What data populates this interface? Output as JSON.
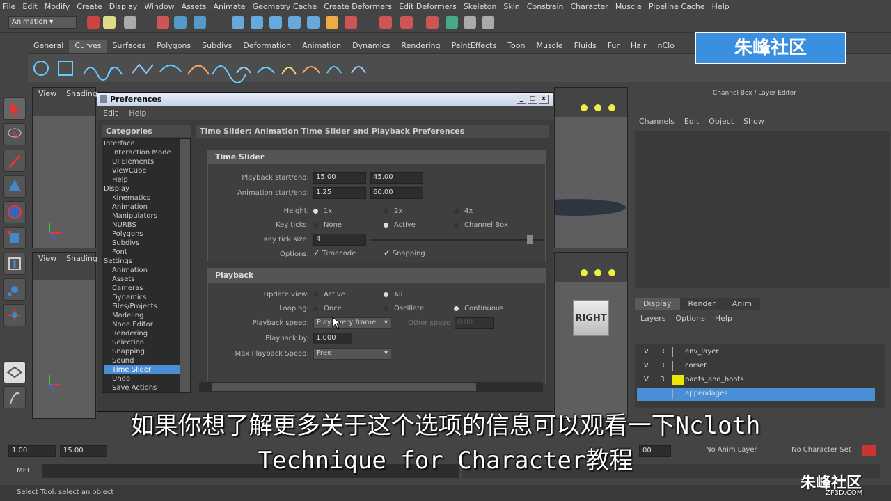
{
  "menubar": [
    "File",
    "Edit",
    "Modify",
    "Create",
    "Display",
    "Window",
    "Assets",
    "Animate",
    "Geometry Cache",
    "Create Deformers",
    "Edit Deformers",
    "Skeleton",
    "Skin",
    "Constrain",
    "Character",
    "Muscle",
    "Pipeline Cache",
    "Help"
  ],
  "mode_selector": "Animation",
  "shelf_tabs": [
    "General",
    "Curves",
    "Surfaces",
    "Polygons",
    "Subdivs",
    "Deformation",
    "Animation",
    "Dynamics",
    "Rendering",
    "PaintEffects",
    "Toon",
    "Muscle",
    "Fluids",
    "Fur",
    "Hair",
    "nClo"
  ],
  "shelf_active": "Curves",
  "viewport": {
    "view": "View",
    "shading": "Shading",
    "cube_label": "RIGHT"
  },
  "prefs": {
    "title": "Preferences",
    "menu": [
      "Edit",
      "Help"
    ],
    "categories_header": "Categories",
    "categories": [
      {
        "label": "Interface",
        "indent": 0
      },
      {
        "label": "Interaction Mode",
        "indent": 1
      },
      {
        "label": "UI Elements",
        "indent": 1
      },
      {
        "label": "ViewCube",
        "indent": 1
      },
      {
        "label": "Help",
        "indent": 1
      },
      {
        "label": "Display",
        "indent": 0
      },
      {
        "label": "Kinematics",
        "indent": 1
      },
      {
        "label": "Animation",
        "indent": 1
      },
      {
        "label": "Manipulators",
        "indent": 1
      },
      {
        "label": "NURBS",
        "indent": 1
      },
      {
        "label": "Polygons",
        "indent": 1
      },
      {
        "label": "Subdivs",
        "indent": 1
      },
      {
        "label": "Font",
        "indent": 1
      },
      {
        "label": "Settings",
        "indent": 0
      },
      {
        "label": "Animation",
        "indent": 1
      },
      {
        "label": "Assets",
        "indent": 1
      },
      {
        "label": "Cameras",
        "indent": 1
      },
      {
        "label": "Dynamics",
        "indent": 1
      },
      {
        "label": "Files/Projects",
        "indent": 1
      },
      {
        "label": "Modeling",
        "indent": 1
      },
      {
        "label": "Node Editor",
        "indent": 1
      },
      {
        "label": "Rendering",
        "indent": 1
      },
      {
        "label": "Selection",
        "indent": 1
      },
      {
        "label": "Snapping",
        "indent": 1
      },
      {
        "label": "Sound",
        "indent": 1
      },
      {
        "label": "Time Slider",
        "indent": 1
      },
      {
        "label": "Undo",
        "indent": 1
      },
      {
        "label": "Save Actions",
        "indent": 1
      }
    ],
    "selected_category": "Time Slider",
    "page_title": "Time Slider: Animation Time Slider and Playback Preferences",
    "time_slider": {
      "header": "Time Slider",
      "playback_label": "Playback start/end:",
      "playback_start": "15.00",
      "playback_end": "45.00",
      "anim_label": "Animation start/end:",
      "anim_start": "1.25",
      "anim_end": "60.00",
      "height_label": "Height:",
      "height_options": [
        "1x",
        "2x",
        "4x"
      ],
      "height_selected": "1x",
      "keyticks_label": "Key ticks:",
      "keyticks_options": [
        "None",
        "Active",
        "Channel Box"
      ],
      "keyticks_selected": "Active",
      "ticksize_label": "Key tick size:",
      "ticksize_value": "4",
      "options_label": "Options:",
      "timecode": "Timecode",
      "snapping": "Snapping"
    },
    "playback": {
      "header": "Playback",
      "update_label": "Update view:",
      "update_options": [
        "Active",
        "All"
      ],
      "update_selected": "All",
      "looping_label": "Looping:",
      "looping_options": [
        "Once",
        "Oscillate",
        "Continuous"
      ],
      "looping_selected": "Continuous",
      "speed_label": "Playback speed:",
      "speed_value": "Play every frame",
      "other_label": "Other speed:",
      "other_value": "0.00",
      "by_label": "Playback by:",
      "by_value": "1.000",
      "max_label": "Max Playback Speed:",
      "max_value": "Free"
    }
  },
  "channel_box": {
    "title": "Channel Box / Layer Editor",
    "menu": [
      "Channels",
      "Edit",
      "Object",
      "Show"
    ],
    "layer_tabs": [
      "Display",
      "Render",
      "Anim"
    ],
    "layer_menu": [
      "Layers",
      "Options",
      "Help"
    ],
    "layers": [
      {
        "v": "V",
        "r": "R",
        "name": "env_layer",
        "color": "",
        "selected": false
      },
      {
        "v": "V",
        "r": "R",
        "name": "corset",
        "color": "",
        "selected": false
      },
      {
        "v": "V",
        "r": "R",
        "name": "pants_and_boots",
        "color": "#e8e800",
        "selected": false
      },
      {
        "v": "",
        "r": "",
        "name": "appendages",
        "color": "",
        "selected": true
      }
    ]
  },
  "timebar": {
    "start": "1.00",
    "current": "15.00",
    "anim_layer": "No Anim Layer",
    "char_set": "No Character Set",
    "end_field": "00"
  },
  "mel_label": "MEL",
  "help_line": "Select Tool: select an object",
  "subtitle_line1": "如果你想了解更多关于这个选项的信息可以观看一下Ncloth",
  "subtitle_line2": "Technique for Character教程",
  "watermark": "朱峰社区",
  "watermark_url": "ZF3D.COM"
}
